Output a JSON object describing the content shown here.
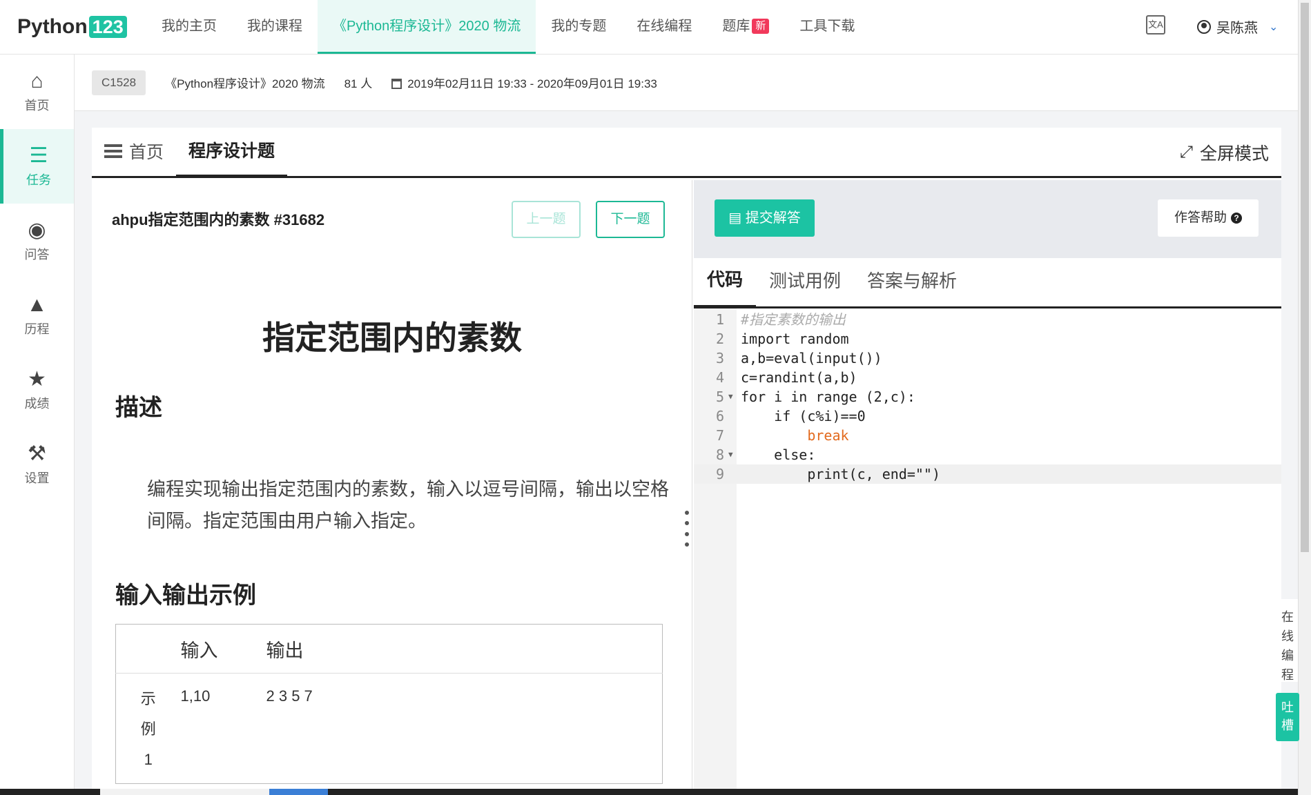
{
  "nav": {
    "logo_text": "Python",
    "logo_num": "123",
    "links": [
      "我的主页",
      "我的课程",
      "《Python程序设计》2020 物流",
      "我的专题",
      "在线编程",
      "题库",
      "工具下载"
    ],
    "badge_new": "新",
    "user_name": "吴陈燕"
  },
  "sidebar": {
    "items": [
      {
        "label": "首页",
        "icon": "home-icon"
      },
      {
        "label": "任务",
        "icon": "tasks-icon"
      },
      {
        "label": "问答",
        "icon": "comments-icon"
      },
      {
        "label": "历程",
        "icon": "tree-icon"
      },
      {
        "label": "成绩",
        "icon": "trophy-icon"
      },
      {
        "label": "设置",
        "icon": "wrench-icon"
      }
    ]
  },
  "course": {
    "code": "C1528",
    "name": "《Python程序设计》2020 物流",
    "members": "81 人",
    "period": "2019年02月11日 19:33 - 2020年09月01日 19:33"
  },
  "tabs": {
    "home": "首页",
    "active": "程序设计题",
    "fullscreen": "全屏模式"
  },
  "problem": {
    "title": "ahpu指定范围内的素数 #31682",
    "prev": "上一题",
    "next": "下一题",
    "heading": "指定范围内的素数",
    "desc_heading": "描述",
    "description": "编程实现输出指定范围内的素数，输入以逗号间隔，输出以空格间隔。指定范围由用户输入指定。",
    "io_heading": "输入输出示例",
    "io_header_input": "输入",
    "io_header_output": "输出",
    "example_label_1": "示",
    "example_label_2": "例",
    "example_label_3": "1",
    "example_input": "1,10",
    "example_output": "2 3 5 7"
  },
  "editor": {
    "submit": "提交解答",
    "help": "作答帮助",
    "tabs": [
      "代码",
      "测试用例",
      "答案与解析"
    ],
    "lines": [
      "#指定素数的输出",
      "import random",
      "a,b=eval(input())",
      "c=randint(a,b)",
      "for i in range (2,c):",
      "    if (c%i)==0",
      "        break",
      "    else:",
      "        print(c, end=\"\")"
    ]
  },
  "float": {
    "online": "在线编程",
    "comment": "吐槽"
  },
  "colors": {
    "accent": "#1cb894",
    "submit": "#1cc3a3",
    "badge": "#f1395b"
  }
}
